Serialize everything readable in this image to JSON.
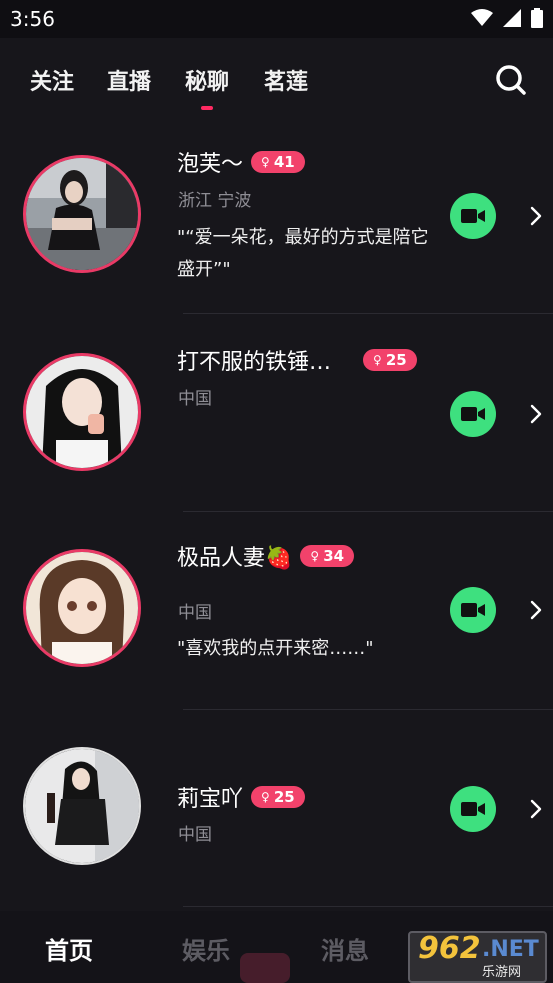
{
  "status_bar": {
    "time": "3:56"
  },
  "top_tabs": [
    {
      "label": "关注",
      "active": false
    },
    {
      "label": "直播",
      "active": false
    },
    {
      "label": "秘聊",
      "active": true
    },
    {
      "label": "茗莲",
      "active": false
    }
  ],
  "users": [
    {
      "name": "泡芙～",
      "badge": "41",
      "location": "浙江 宁波",
      "quote": "\"“爱一朵花，最好的方式是陪它盛开”\""
    },
    {
      "name": "打不服的铁锤…",
      "badge": "25",
      "location": "中国",
      "quote": ""
    },
    {
      "name": "极品人妻🍓",
      "badge": "34",
      "location": "中国",
      "quote": "\"喜欢我的点开来密……\""
    },
    {
      "name": "莉宝吖",
      "badge": "25",
      "location": "中国",
      "quote": ""
    }
  ],
  "badge_symbol": "♀",
  "bottom_tabs": [
    {
      "label": "首页",
      "active": true
    },
    {
      "label": "娱乐",
      "active": false
    },
    {
      "label": "消息",
      "active": false
    }
  ],
  "watermark": {
    "big": "962",
    "net": ".NET",
    "sub": "乐游网"
  },
  "colors": {
    "accent": "#ff2a62",
    "badge": "#f2426b",
    "video": "#3ee07f"
  },
  "icons": [
    "wifi-icon",
    "signal-icon",
    "battery-icon",
    "search-icon",
    "video-camera-icon",
    "chevron-right-icon"
  ]
}
